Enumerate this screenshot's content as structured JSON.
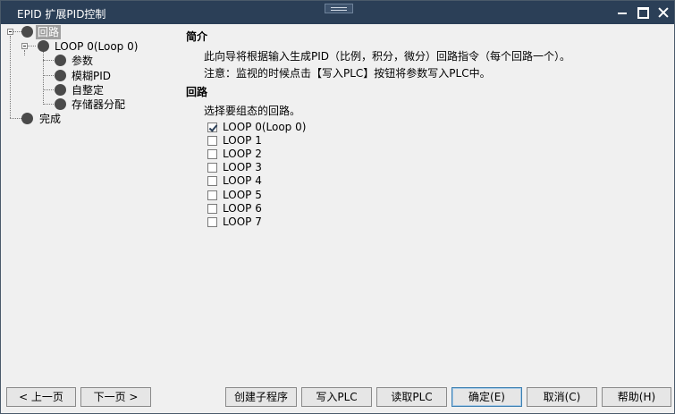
{
  "window": {
    "title": "EPID 扩展PID控制"
  },
  "tree": {
    "root": "回路",
    "loop": "LOOP 0(Loop 0)",
    "children": [
      "参数",
      "模糊PID",
      "自整定",
      "存储器分配"
    ],
    "done": "完成"
  },
  "intro": {
    "heading": "简介",
    "line1": "此向导将根据输入生成PID（比例，积分，微分）回路指令（每个回路一个）。",
    "line2": "注意：监视的时候点击【写入PLC】按钮将参数写入PLC中。"
  },
  "loops": {
    "heading": "回路",
    "prompt": "选择要组态的回路。",
    "items": [
      {
        "label": "LOOP 0(Loop 0)",
        "checked": true
      },
      {
        "label": "LOOP 1",
        "checked": false
      },
      {
        "label": "LOOP 2",
        "checked": false
      },
      {
        "label": "LOOP 3",
        "checked": false
      },
      {
        "label": "LOOP 4",
        "checked": false
      },
      {
        "label": "LOOP 5",
        "checked": false
      },
      {
        "label": "LOOP 6",
        "checked": false
      },
      {
        "label": "LOOP 7",
        "checked": false
      }
    ]
  },
  "buttons": {
    "prev": "< 上一页",
    "next": "下一页 >",
    "create_sub": "创建子程序",
    "write_plc": "写入PLC",
    "read_plc": "读取PLC",
    "ok": "确定(E)",
    "cancel": "取消(C)",
    "help": "帮助(H)"
  }
}
